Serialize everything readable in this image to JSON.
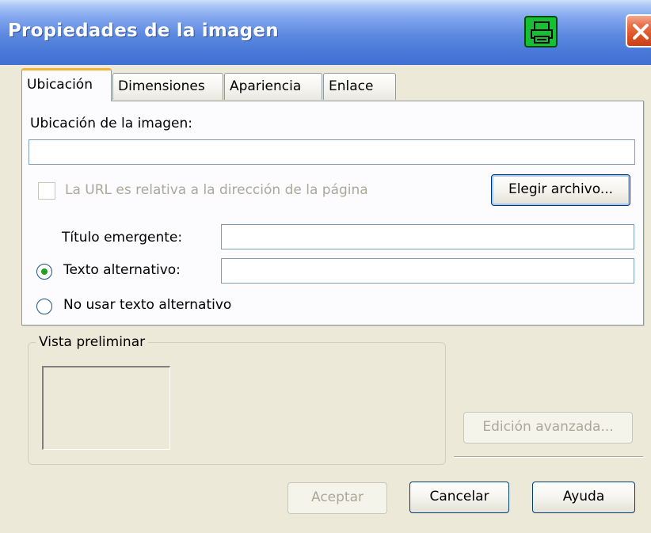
{
  "window": {
    "title": "Propiedades de la imagen",
    "app_icon": "green-printer-icon",
    "close_icon": "close-icon"
  },
  "tabs": [
    {
      "label": "Ubicación",
      "active": true
    },
    {
      "label": "Dimensiones",
      "active": false
    },
    {
      "label": "Apariencia",
      "active": false
    },
    {
      "label": "Enlace",
      "active": false
    }
  ],
  "location": {
    "image_location_label": "Ubicación de la imagen:",
    "image_location_value": "",
    "relative_url_label": "La URL es relativa a la dirección de la página",
    "relative_url_checked": false,
    "choose_file_label": "Elegir archivo..."
  },
  "tooltip_title": {
    "label": "Título emergente:",
    "value": ""
  },
  "alt_text": {
    "label": "Texto alternativo:",
    "value": "",
    "selected": true
  },
  "no_alt_text": {
    "label": "No usar texto alternativo",
    "selected": false
  },
  "preview": {
    "group_label": "Vista preliminar"
  },
  "advanced_edit_label": "Edición avanzada...",
  "buttons": {
    "accept": "Aceptar",
    "cancel": "Cancelar",
    "help": "Ayuda"
  },
  "colors": {
    "titlebar": "#4d7bd9",
    "dialog_bg": "#ece9d8",
    "active_tab_accent": "#f0b43c",
    "radio_dot": "#21a121",
    "close_button": "#dc4f20"
  }
}
